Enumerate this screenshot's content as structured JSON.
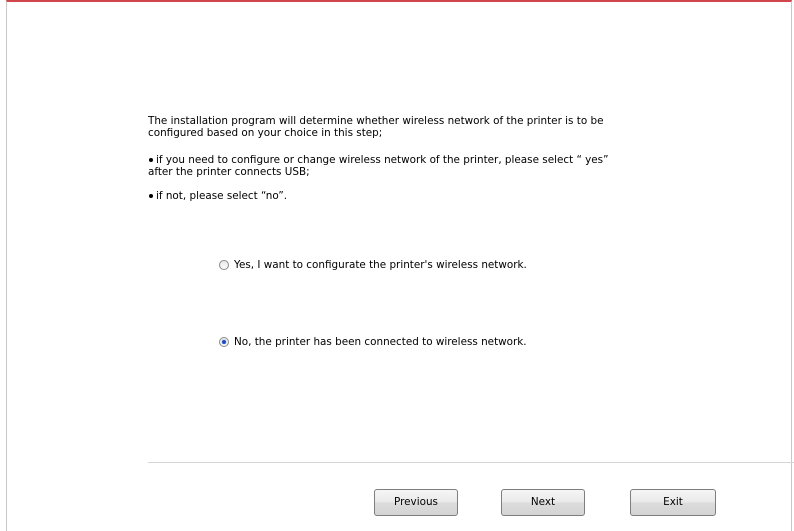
{
  "instructions": {
    "intro": "The installation program will determine whether wireless network of the printer is to be configured based on your choice in this step;",
    "bullet_configure": "if you need to configure or change wireless network of the printer, please select “ yes” after the printer connects USB;",
    "bullet_not": "if not, please select “no”."
  },
  "options": {
    "yes_label": "Yes, I want to configurate the printer's wireless network.",
    "no_label": "No, the printer has been connected to wireless network.",
    "selected": "no"
  },
  "buttons": {
    "previous": "Previous",
    "next": "Next",
    "exit": "Exit"
  },
  "colors": {
    "title_accent": "#d0464b",
    "radio_selected": "#1f4fbf"
  }
}
